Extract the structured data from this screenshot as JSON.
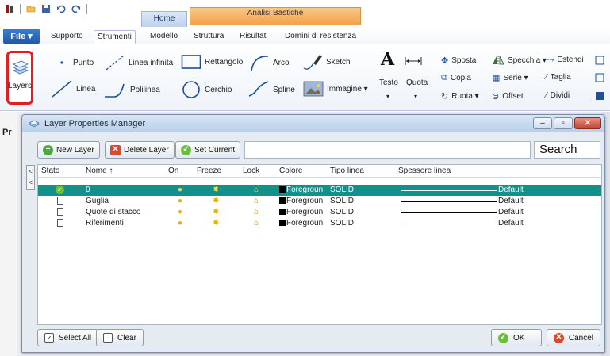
{
  "ribbon": {
    "file_label": "File ▾",
    "contextual_group": "Analisi Bastiche",
    "home_tab": "Home",
    "tabs": [
      "Supporto",
      "Strumenti",
      "Modello",
      "Struttura",
      "Risultati",
      "Domini di resistenza"
    ],
    "active_tab": "Strumenti",
    "layers_label": "Layers",
    "draw_items": {
      "punto": "Punto",
      "linea_infinita": "Linea infinita",
      "rettangolo": "Rettangolo",
      "arco": "Arco",
      "sketch": "Sketch",
      "linea": "Linea",
      "polilinea": "Polilinea",
      "cerchio": "Cerchio",
      "spline": "Spline",
      "immagine": "Immagine ▾"
    },
    "text_items": {
      "testo": "Testo",
      "quota": "Quota",
      "testo_arrow": "▾",
      "quota_arrow": "▾"
    },
    "modify_items": {
      "sposta": "Sposta",
      "specchia": "Specchia ▾",
      "estendi": "Estendi",
      "copia": "Copia",
      "serie": "Serie ▾",
      "taglia": "Taglia",
      "ruota": "Ruota ▾",
      "offset": "Offset",
      "dividi": "Dividi"
    }
  },
  "side_panel": {
    "label": "Pr"
  },
  "dialog": {
    "title": "Layer Properties Manager",
    "window_buttons": {
      "minimize": "–",
      "maximize": "▫",
      "close": "✕"
    },
    "toolbar": {
      "new_layer": "New Layer",
      "delete_layer": "Delete Layer",
      "set_current": "Set Current",
      "search_value": "",
      "search_label": "Search"
    },
    "collapse_glyph": "< <",
    "columns": [
      "Stato",
      "Nome ↑",
      "On",
      "Freeze",
      "Lock",
      "Colore",
      "Tipo linea",
      "Spessore linea"
    ],
    "layers": [
      {
        "name": "0",
        "color": "Foregroun",
        "linetype": "SOLID",
        "lineweight": "Default",
        "current": true,
        "selected": true
      },
      {
        "name": "Guglia",
        "color": "Foregroun",
        "linetype": "SOLID",
        "lineweight": "Default",
        "current": false,
        "selected": false
      },
      {
        "name": "Quote di stacco",
        "color": "Foregroun",
        "linetype": "SOLID",
        "lineweight": "Default",
        "current": false,
        "selected": false
      },
      {
        "name": "Riferimenti",
        "color": "Foregroun",
        "linetype": "SOLID",
        "lineweight": "Default",
        "current": false,
        "selected": false
      }
    ],
    "footer": {
      "select_all": "Select All",
      "clear": "Clear",
      "ok": "OK",
      "cancel": "Cancel"
    }
  },
  "colors": {
    "selection": "#13908a",
    "highlight_border": "#e02020",
    "contextual_tab": "#f3a24b"
  }
}
